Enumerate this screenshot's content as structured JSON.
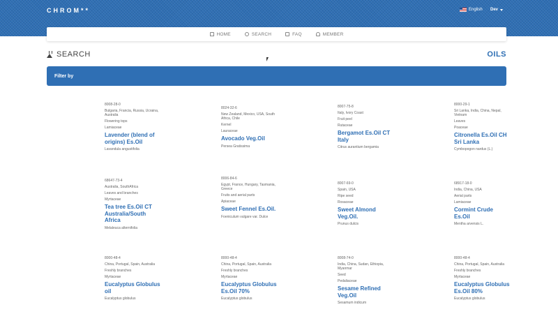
{
  "header": {
    "logo": "CHROM**",
    "language": "English",
    "user": "Dev"
  },
  "nav": {
    "items": [
      {
        "label": "HOME",
        "icon": "home-icon"
      },
      {
        "label": "SEARCH",
        "icon": "search-icon"
      },
      {
        "label": "FAQ",
        "icon": "faq-icon"
      },
      {
        "label": "MEMBER",
        "icon": "member-icon"
      }
    ]
  },
  "page": {
    "title": "SEARCH",
    "category": "OILS",
    "filter_label": "Filter by"
  },
  "colors": {
    "accent": "#2f6fb4"
  },
  "products": [
    {
      "cas": "8008-28-0",
      "origin": "Bulgaria, Francia, Russia, Ucraina, Australia",
      "part": "Flowering tops",
      "family": "Lamiaceae",
      "name": "Lavender (blend of origins) Es.Oil",
      "latin": "Lavandula angustifolia"
    },
    {
      "cas": "8024-32-6",
      "origin": "New Zealand, Mexico, USA, South Africa, Chile",
      "part": "Kernel",
      "family": "Lauraceae",
      "name": "Avocado Veg.Oil",
      "latin": "Persea Gratissima"
    },
    {
      "cas": "8007-75-8",
      "origin": "Italy, Ivory Coast",
      "part": "Fruit peel",
      "family": "Rutaceae",
      "name": "Bergamot Es.Oil CT Italy",
      "latin": "Citrus aurantium bergamia"
    },
    {
      "cas": "8000-29-1",
      "origin": "Sri Lanka, India, China, Nepal, Vietnam",
      "part": "Leaves",
      "family": "Poaceae",
      "name": "Citronella Es.Oil CH Sri Lanka",
      "latin": "Cymbopogon nardus (L.)"
    },
    {
      "cas": "68647-73-4",
      "origin": "Australia, SouthAfrica",
      "part": "Leaves and branches",
      "family": "Myrtaceae",
      "name": "Tea tree Es.Oil CT Australia/South Africa",
      "latin": "Melaleuca alternifolia"
    },
    {
      "cas": "8006-84-6",
      "origin": "Egypt, France, Hungary, Tasmania, Greece",
      "part": "Fruits and aerial parts",
      "family": "Apiaceae",
      "name": "Sweet Fennel Es.Oil.",
      "latin": "Foeniculum vulgare var. Dulce"
    },
    {
      "cas": "8007-69-0",
      "origin": "Spain, USA",
      "part": "Ripe seed",
      "family": "Rosaceae",
      "name": "Sweet Almond Veg.Oil.",
      "latin": "Prunus dulcis"
    },
    {
      "cas": "68917-18-0",
      "origin": "India, China, USA",
      "part": "Aerial parts",
      "family": "Lamiaceae",
      "name": "Cormint Crude Es.Oil",
      "latin": "Mentha arvensis L."
    },
    {
      "cas": "8000-48-4",
      "origin": "China, Portugal, Spain, Australia",
      "part": "Freshly branches",
      "family": "Myrtaceae",
      "name": "Eucalyptus Globulus oil",
      "latin": "Eucalyptus globulus"
    },
    {
      "cas": "8000-48-4",
      "origin": "China, Portugal, Spain, Australia",
      "part": "Freshly branches",
      "family": "Myrtaceae",
      "name": "Eucalyptus Globulus Es.Oil 70%",
      "latin": "Eucalyptus globulus"
    },
    {
      "cas": "8008-74-0",
      "origin": "India, China, Sudan, Ethiopia, Myanmar",
      "part": "Seed",
      "family": "Pedaliaceae",
      "name": "Sesame Refined Veg.Oil",
      "latin": "Sesamum indicum"
    },
    {
      "cas": "8000-48-4",
      "origin": "China, Portugal, Spain, Australia",
      "part": "Freshly branches",
      "family": "Myrtaceae",
      "name": "Eucalyptus Globulus Es.Oil 80%",
      "latin": "Eucalyptus globulus"
    }
  ]
}
